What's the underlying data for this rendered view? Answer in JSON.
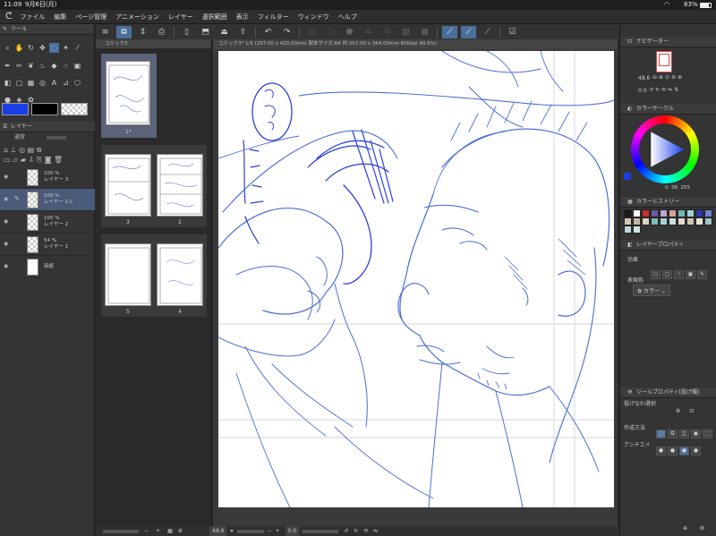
{
  "status": {
    "time": "11:09",
    "date": "9月6日(月)",
    "battery": "83%"
  },
  "menu": [
    "ファイル",
    "編集",
    "ページ管理",
    "アニメーション",
    "レイヤー",
    "選択範囲",
    "表示",
    "フィルター",
    "ウィンドウ",
    "ヘルプ"
  ],
  "toolPanel": {
    "title": "ツール"
  },
  "layerPanel": {
    "title": "レイヤー",
    "blend": "通常",
    "layers": [
      {
        "opacity": "100 %",
        "name": "レイヤー 3",
        "selected": false,
        "thumb": "checker"
      },
      {
        "opacity": "100 %",
        "name": "レイヤー 2 C",
        "selected": true,
        "thumb": "checker"
      },
      {
        "opacity": "100 %",
        "name": "レイヤー 2",
        "selected": false,
        "thumb": "checker"
      },
      {
        "opacity": "54 %",
        "name": "レイヤー 1",
        "selected": false,
        "thumb": "checker"
      },
      {
        "opacity": "",
        "name": "用紙",
        "selected": false,
        "thumb": "white"
      }
    ]
  },
  "pagePanel": {
    "tab": "コミック3",
    "pages": [
      "1*",
      "3",
      "2",
      "5",
      "4"
    ]
  },
  "canvas": {
    "tab": "コミック3* 1/5 (297.00 x 420.00mm 製本サイズ:B4 判 257.00 x 364.00mm 600dpi 48.6%)",
    "zoom": "48.6",
    "angle": "0.0"
  },
  "navigator": {
    "title": "ナビゲーター",
    "zoom": "48.6",
    "angle": "0.0"
  },
  "colorWheel": {
    "title": "カラーサークル",
    "h": "0",
    "s": "38",
    "v": "255"
  },
  "colorHistory": {
    "title": "カラーヒストリー",
    "swatches": [
      "#1a1a1a",
      "#ffffff",
      "#c8302a",
      "#6b5b9e",
      "#b9a6d6",
      "#d9a19a",
      "#73b6b1",
      "#9fd0cd",
      "#2c3aa8",
      "#6d85d6",
      "#d8c6b2",
      "#c2b7a5",
      "#d9d1c4",
      "#7fbab4",
      "#a7cfd1",
      "#c9e1e0",
      "#e3d7cb",
      "#d4c3b2",
      "#ebe3da",
      "#9fc5c3",
      "#b9d6d5",
      "#d1e4e3"
    ]
  },
  "layerProp": {
    "title": "レイヤープロパティ",
    "effect": "効果",
    "color": "表現色",
    "colorValue": "カラー"
  },
  "toolProp": {
    "title": "ツールプロパティ[投げ縄]",
    "tool": "投げなわ選択",
    "method": "作成方法",
    "antialias": "アンチエイ"
  },
  "colors": {
    "main": "#1a3ee6",
    "sub": "#000000",
    "accent": "#4a6f9a",
    "sketch": "#4b6fd6"
  }
}
